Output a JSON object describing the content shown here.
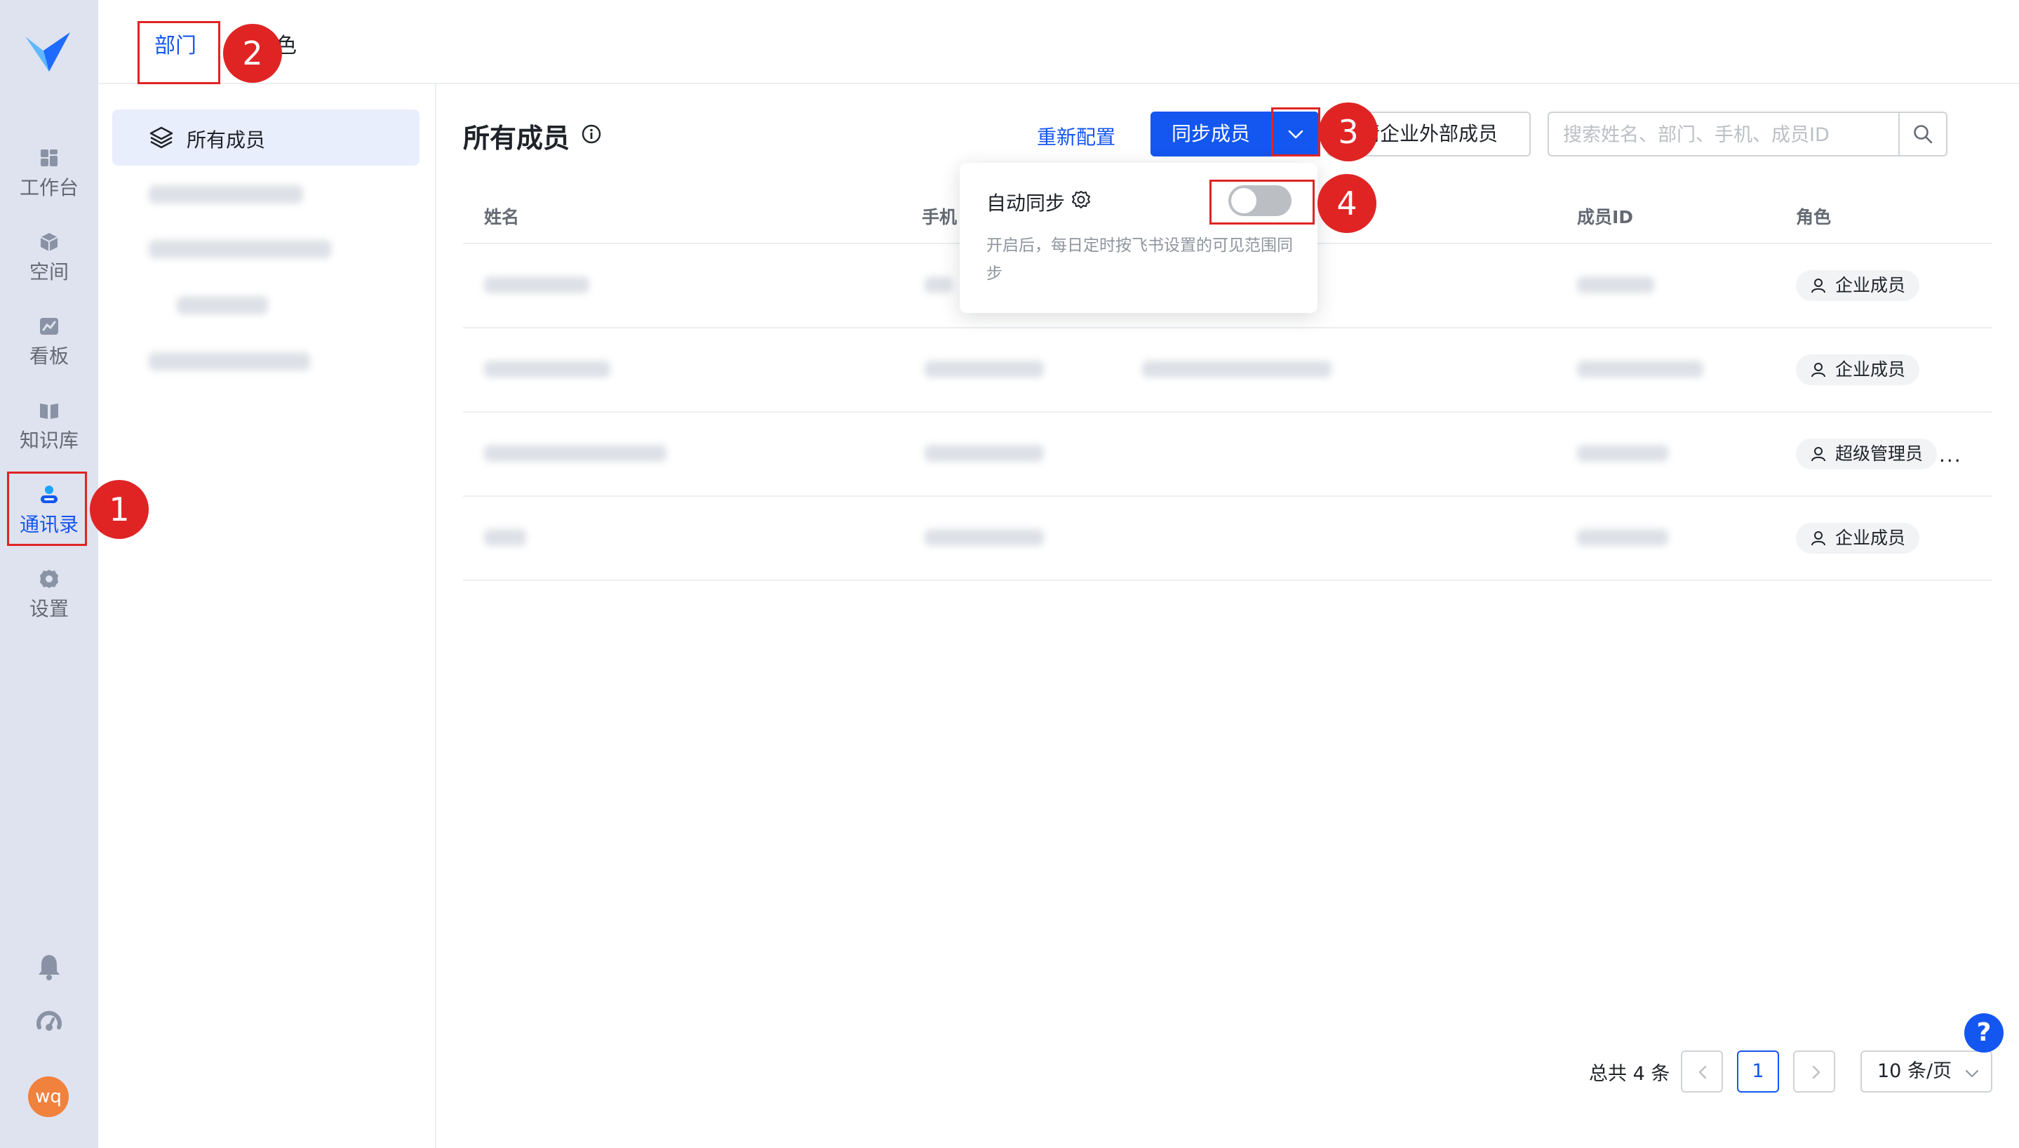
{
  "nav": {
    "items": [
      {
        "label": "工作台",
        "icon": "grid-icon"
      },
      {
        "label": "空间",
        "icon": "cube-icon"
      },
      {
        "label": "看板",
        "icon": "chart-icon"
      },
      {
        "label": "知识库",
        "icon": "book-icon"
      },
      {
        "label": "通讯录",
        "icon": "contacts-icon",
        "active": true
      },
      {
        "label": "设置",
        "icon": "gear-icon"
      }
    ],
    "avatar_initials": "wq"
  },
  "tabs": {
    "dept": "部门",
    "role": "色"
  },
  "tree": {
    "active_label": "所有成员"
  },
  "header": {
    "title": "所有成员",
    "reconfig": "重新配置",
    "sync": "同步成员",
    "invite": "请企业外部成员",
    "search_placeholder": "搜索姓名、部门、手机、成员ID"
  },
  "table": {
    "columns": {
      "name": "姓名",
      "phone": "手机",
      "member_id": "成员ID",
      "role": "角色"
    },
    "rows": [
      {
        "role": "企业成员"
      },
      {
        "role": "企业成员"
      },
      {
        "role": "超级管理员",
        "more": "..."
      },
      {
        "role": "企业成员"
      }
    ]
  },
  "popover": {
    "title": "自动同步",
    "description": "开启后，每日定时按飞书设置的可见范围同步",
    "toggle_on": false
  },
  "pagination": {
    "total": "总共 4 条",
    "current_page": "1",
    "page_size": "10 条/页"
  },
  "help_fab": "?",
  "callouts": [
    "1",
    "2",
    "3",
    "4"
  ],
  "colors": {
    "primary": "#1456f0",
    "rail_bg": "#dfe3ef",
    "callout_red": "#e02424",
    "avatar_orange": "#f0823e"
  }
}
